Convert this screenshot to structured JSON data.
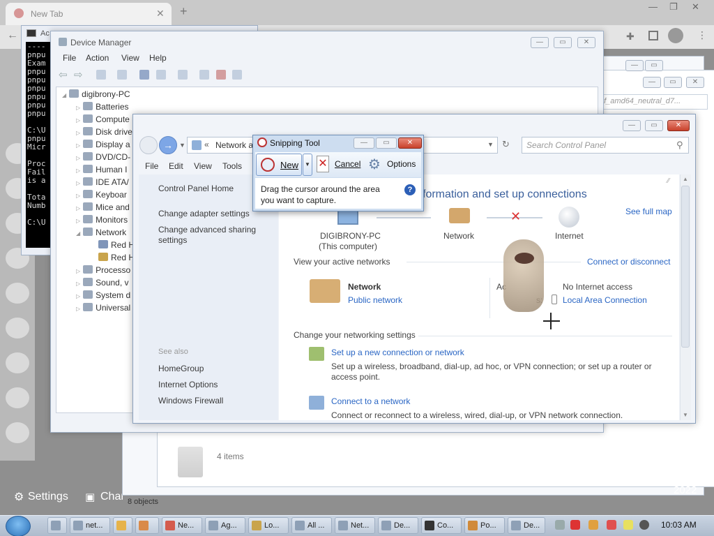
{
  "browser": {
    "tab_title": "New Tab",
    "new_tab_glyph": "+",
    "settings_label": "Settings",
    "channel_label": "Char",
    "social_icons": [
      "gmail-icon",
      "youtube-icon",
      "facebook-icon",
      "instagram-icon",
      "pinterest-icon",
      "twitter-icon",
      "whatsapp-icon",
      "telegram-icon",
      "reddit-icon"
    ]
  },
  "console": {
    "title": "Ac",
    "lines": [
      "----",
      "pnpu",
      "Exam",
      "pnpu",
      "pnpu",
      "pnpu",
      "pnpu",
      "pnpu",
      "pnpu",
      "",
      "C:\\U",
      "pnpu",
      "Micr",
      "",
      "Proc",
      "Fail",
      "is a",
      "",
      "Tota",
      "Numb",
      "",
      "C:\\U"
    ]
  },
  "device_manager": {
    "title": "Device Manager",
    "menu": [
      "File",
      "Action",
      "View",
      "Help"
    ],
    "root": "digibrony-PC",
    "tree": [
      "Batteries",
      "Compute",
      "Disk drive",
      "Display a",
      "DVD/CD-",
      "Human I",
      "IDE ATA/",
      "Keyboar",
      "Mice and",
      "Monitors",
      "Network",
      "Red H",
      "Red H",
      "Processo",
      "Sound, v",
      "System d",
      "Universal"
    ]
  },
  "explorer": {
    "path": "nf_amd64_neutral_d7...",
    "items_count": "4 items",
    "objects": "8 objects",
    "year": "2022"
  },
  "network_center": {
    "breadcrumb_prefix": "«",
    "breadcrumb": "Network a",
    "search_placeholder": "Search Control Panel",
    "menu": [
      "File",
      "Edit",
      "View",
      "Tools"
    ],
    "left_links": [
      "Control Panel Home",
      "Change adapter settings",
      "Change advanced sharing settings"
    ],
    "see_also_label": "See also",
    "see_also": [
      "HomeGroup",
      "Internet Options",
      "Windows Firewall"
    ],
    "heading": "formation and set up connections",
    "see_full_map": "See full map",
    "map": {
      "computer": "DIGIBRONY-PC",
      "computer_sub": "(This computer)",
      "network": "Network",
      "internet": "Internet"
    },
    "active_networks_label": "View your active networks",
    "connect_disconnect": "Connect or disconnect",
    "network_name": "Network",
    "network_type": "Public network",
    "access_label_prefix": "Ac",
    "connections_label_suffix": "s:",
    "access_value": "No Internet access",
    "connection_value": "Local Area Connection",
    "change_settings_label": "Change your networking settings",
    "tasks": [
      {
        "title": "Set up a new connection or network",
        "desc": "Set up a wireless, broadband, dial-up, ad hoc, or VPN connection; or set up a router or access point."
      },
      {
        "title": "Connect to a network",
        "desc": "Connect or reconnect to a wireless, wired, dial-up, or VPN network connection."
      }
    ]
  },
  "snipping_tool": {
    "title": "Snipping Tool",
    "new_label": "New",
    "cancel_label": "Cancel",
    "options_label": "Options",
    "instruction": "Drag the cursor around the area you want to capture.",
    "help_glyph": "?"
  },
  "taskbar": {
    "items": [
      "net...",
      "",
      "",
      "Ne...",
      "Ag...",
      "Lo...",
      "All ...",
      "Net...",
      "De...",
      "Co...",
      "Po...",
      "De..."
    ],
    "clock": "10:03 AM"
  }
}
